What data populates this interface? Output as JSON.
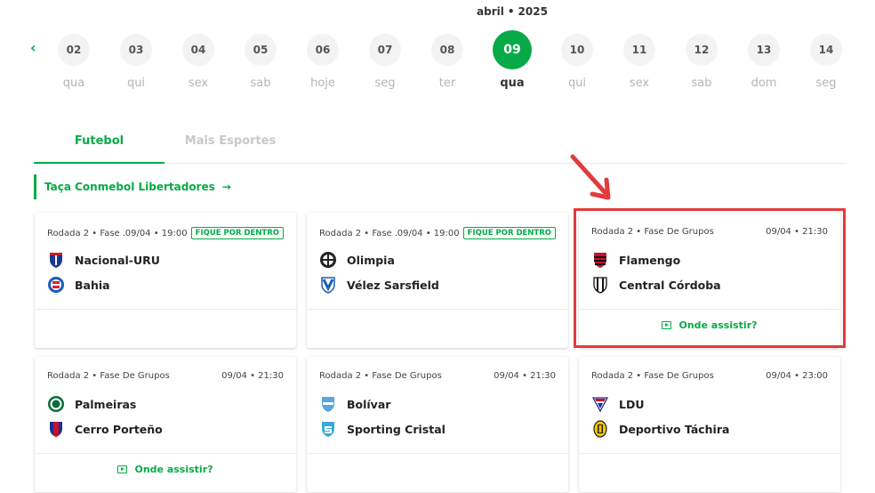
{
  "calendar": {
    "month": "abril",
    "year": "2025",
    "prev_icon": "chevron-left-icon",
    "days": [
      {
        "num": "02",
        "weekday": "qua"
      },
      {
        "num": "03",
        "weekday": "qui"
      },
      {
        "num": "04",
        "weekday": "sex"
      },
      {
        "num": "05",
        "weekday": "sab"
      },
      {
        "num": "06",
        "weekday": "hoje"
      },
      {
        "num": "07",
        "weekday": "seg"
      },
      {
        "num": "08",
        "weekday": "ter"
      },
      {
        "num": "09",
        "weekday": "qua",
        "active": true
      },
      {
        "num": "10",
        "weekday": "qui"
      },
      {
        "num": "11",
        "weekday": "sex"
      },
      {
        "num": "12",
        "weekday": "sab"
      },
      {
        "num": "13",
        "weekday": "dom"
      },
      {
        "num": "14",
        "weekday": "seg"
      }
    ]
  },
  "tabs": [
    {
      "label": "Futebol",
      "active": true
    },
    {
      "label": "Mais Esportes",
      "active": false
    }
  ],
  "league": {
    "title": "Taça Conmebol Libertadores",
    "icon": "arrow-right-icon"
  },
  "matches": [
    {
      "round": "Rodada 2 • Fase ...",
      "datetime": "09/04 • 19:00",
      "badge": "FIQUE POR DENTRO",
      "home": "Nacional-URU",
      "away": "Bahia",
      "watch": ""
    },
    {
      "round": "Rodada 2 • Fase ...",
      "datetime": "09/04 • 19:00",
      "badge": "FIQUE POR DENTRO",
      "home": "Olimpia",
      "away": "Vélez Sarsfield",
      "watch": ""
    },
    {
      "round": "Rodada 2 • Fase De Grupos",
      "datetime": "09/04 • 21:30",
      "badge": "",
      "home": "Flamengo",
      "away": "Central Córdoba",
      "watch": "Onde assistir?"
    },
    {
      "round": "Rodada 2 • Fase De Grupos",
      "datetime": "09/04 • 21:30",
      "badge": "",
      "home": "Palmeiras",
      "away": "Cerro Porteño",
      "watch": "Onde assistir?"
    },
    {
      "round": "Rodada 2 • Fase De Grupos",
      "datetime": "09/04 • 21:30",
      "badge": "",
      "home": "Bolívar",
      "away": "Sporting Cristal",
      "watch": ""
    },
    {
      "round": "Rodada 2 • Fase De Grupos",
      "datetime": "09/04 • 23:00",
      "badge": "",
      "home": "LDU",
      "away": "Deportivo Táchira",
      "watch": ""
    }
  ],
  "colors": {
    "accent": "#06aa48",
    "annotation": "#e23b3b"
  }
}
